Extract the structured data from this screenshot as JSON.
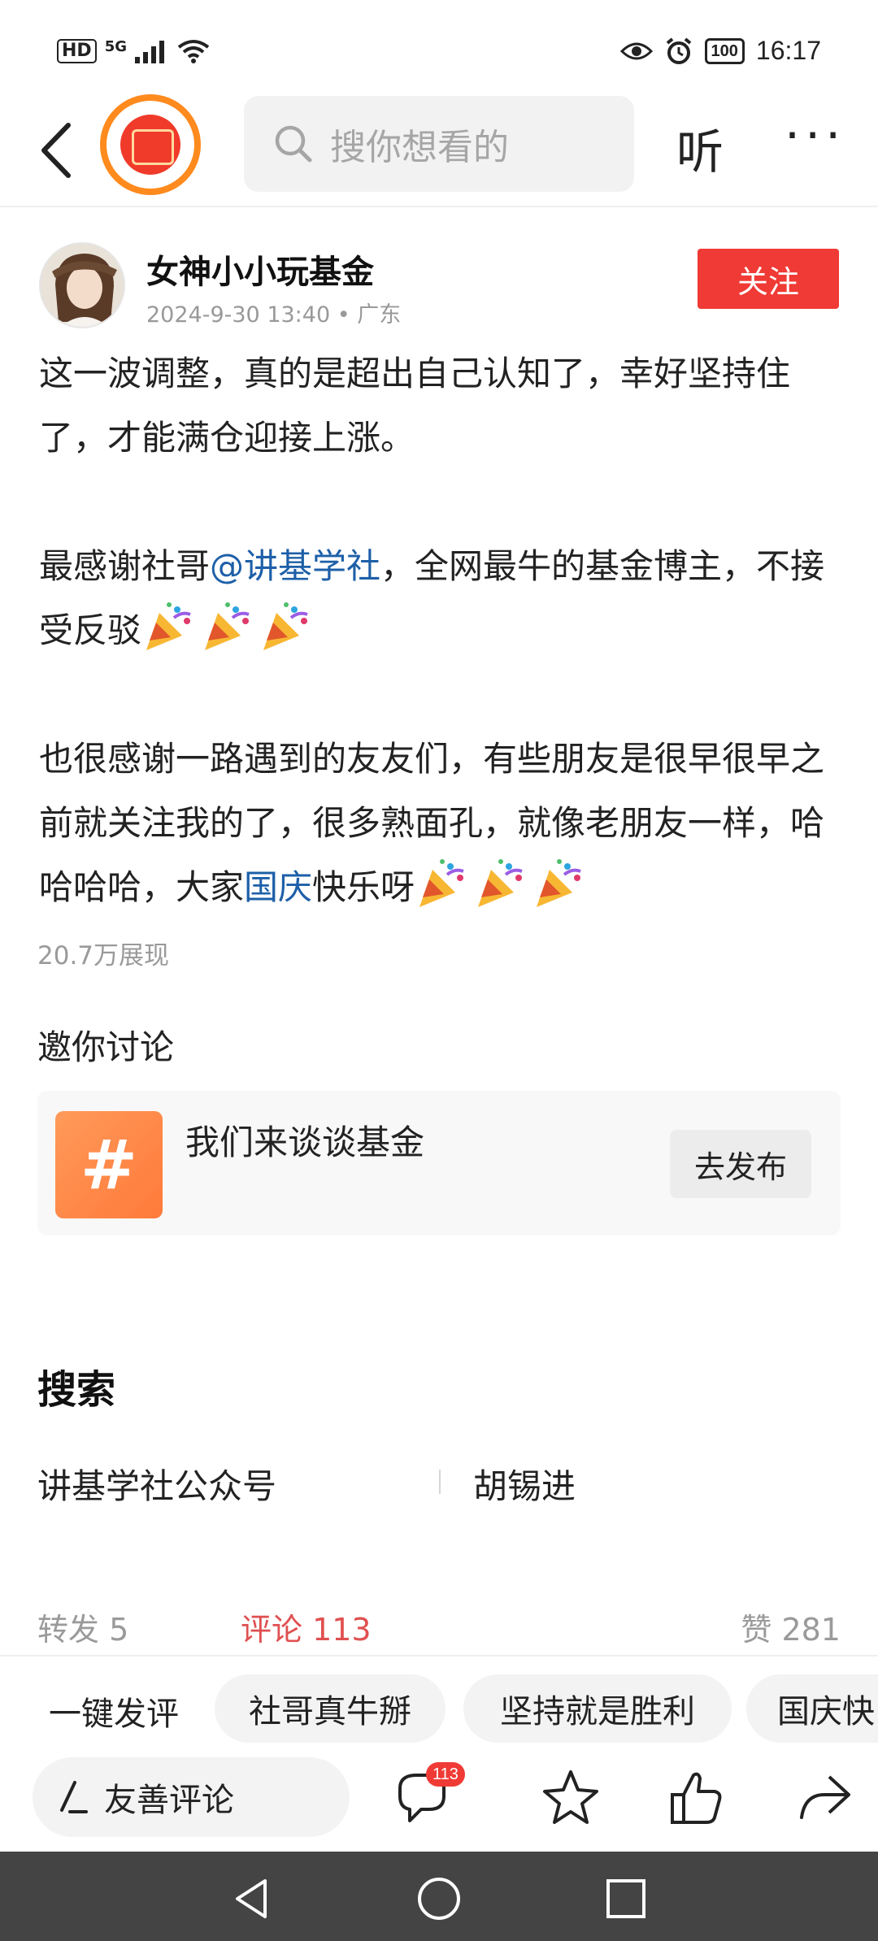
{
  "status_bar": {
    "hd": "HD",
    "network": "5G",
    "battery": "100",
    "time": "16:17"
  },
  "nav": {
    "search_placeholder": "搜你想看的",
    "listen_label": "听",
    "more_label": "···"
  },
  "post": {
    "author": "女神小小玩基金",
    "meta": "2024-9-30 13:40 • 广东",
    "follow_label": "关注",
    "para1": "这一波调整，真的是超出自己认知了，幸好坚持住了，才能满仓迎接上涨。",
    "para2_prefix": "最感谢社哥",
    "para2_mention": "@讲基学社",
    "para2_suffix": "，全网最牛的基金博主，不接受反驳",
    "para3_prefix": "也很感谢一路遇到的友友们，有些朋友是很早很早之前就关注我的了，很多熟面孔，就像老朋友一样，哈哈哈哈，大家",
    "para3_hashtag": "国庆",
    "para3_suffix": "快乐呀",
    "views": "20.7万展现"
  },
  "invite": {
    "title": "邀你讨论",
    "topic_icon": "#",
    "topic_title": "我们来谈谈基金",
    "publish_label": "去发布"
  },
  "search_section": {
    "title": "搜索",
    "items": [
      "讲基学社公众号",
      "胡锡进"
    ]
  },
  "stats": {
    "repost": "转发 5",
    "comment": "评论 113",
    "like": "赞 281"
  },
  "quick_comments": {
    "label": "一键发评",
    "chips": [
      "社哥真牛掰",
      "坚持就是胜利",
      "国庆快"
    ]
  },
  "bottom_bar": {
    "comment_placeholder": "友善评论",
    "comment_count": "113"
  },
  "colors": {
    "accent_red": "#f03a35",
    "link_blue": "#1d5fa8",
    "comment_red": "#e05050",
    "topic_orange": "#ff8a45"
  },
  "icons": [
    "back-icon",
    "red-packet-icon",
    "search-icon",
    "party-popper-icon",
    "hashtag-icon",
    "comment-icon",
    "star-icon",
    "thumbs-up-icon",
    "share-icon",
    "pen-icon",
    "nav-back-icon",
    "nav-home-icon",
    "nav-recents-icon"
  ]
}
